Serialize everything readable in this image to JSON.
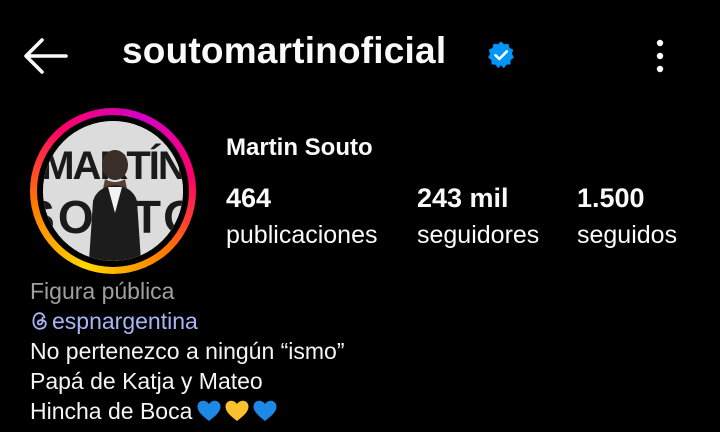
{
  "header": {
    "username": "soutomartinoficial",
    "back_icon": "arrow-left-icon",
    "verified_icon": "verified-badge-icon",
    "more_icon": "more-vertical-icon"
  },
  "profile": {
    "display_name": "Martin Souto",
    "avatar_text_top": "MARTÍN",
    "avatar_text_bottom": "SOUTO",
    "stats": {
      "posts": {
        "value": "464",
        "label": "publicaciones"
      },
      "followers": {
        "value": "243 mil",
        "label": "seguidores"
      },
      "following": {
        "value": "1.500",
        "label": "seguidos"
      }
    }
  },
  "bio": {
    "category": "Figura pública",
    "mention": "espnargentina",
    "lines": [
      "No pertenezco a ningún “ismo”",
      "Papá de Katja y Mateo",
      "Hincha de Boca"
    ],
    "emoji_colors": [
      "#1e88e5",
      "#fbc02d",
      "#1e88e5"
    ]
  },
  "colors": {
    "background": "#000000",
    "verified_blue": "#0095f6",
    "mention_color": "#a9b6f5"
  }
}
